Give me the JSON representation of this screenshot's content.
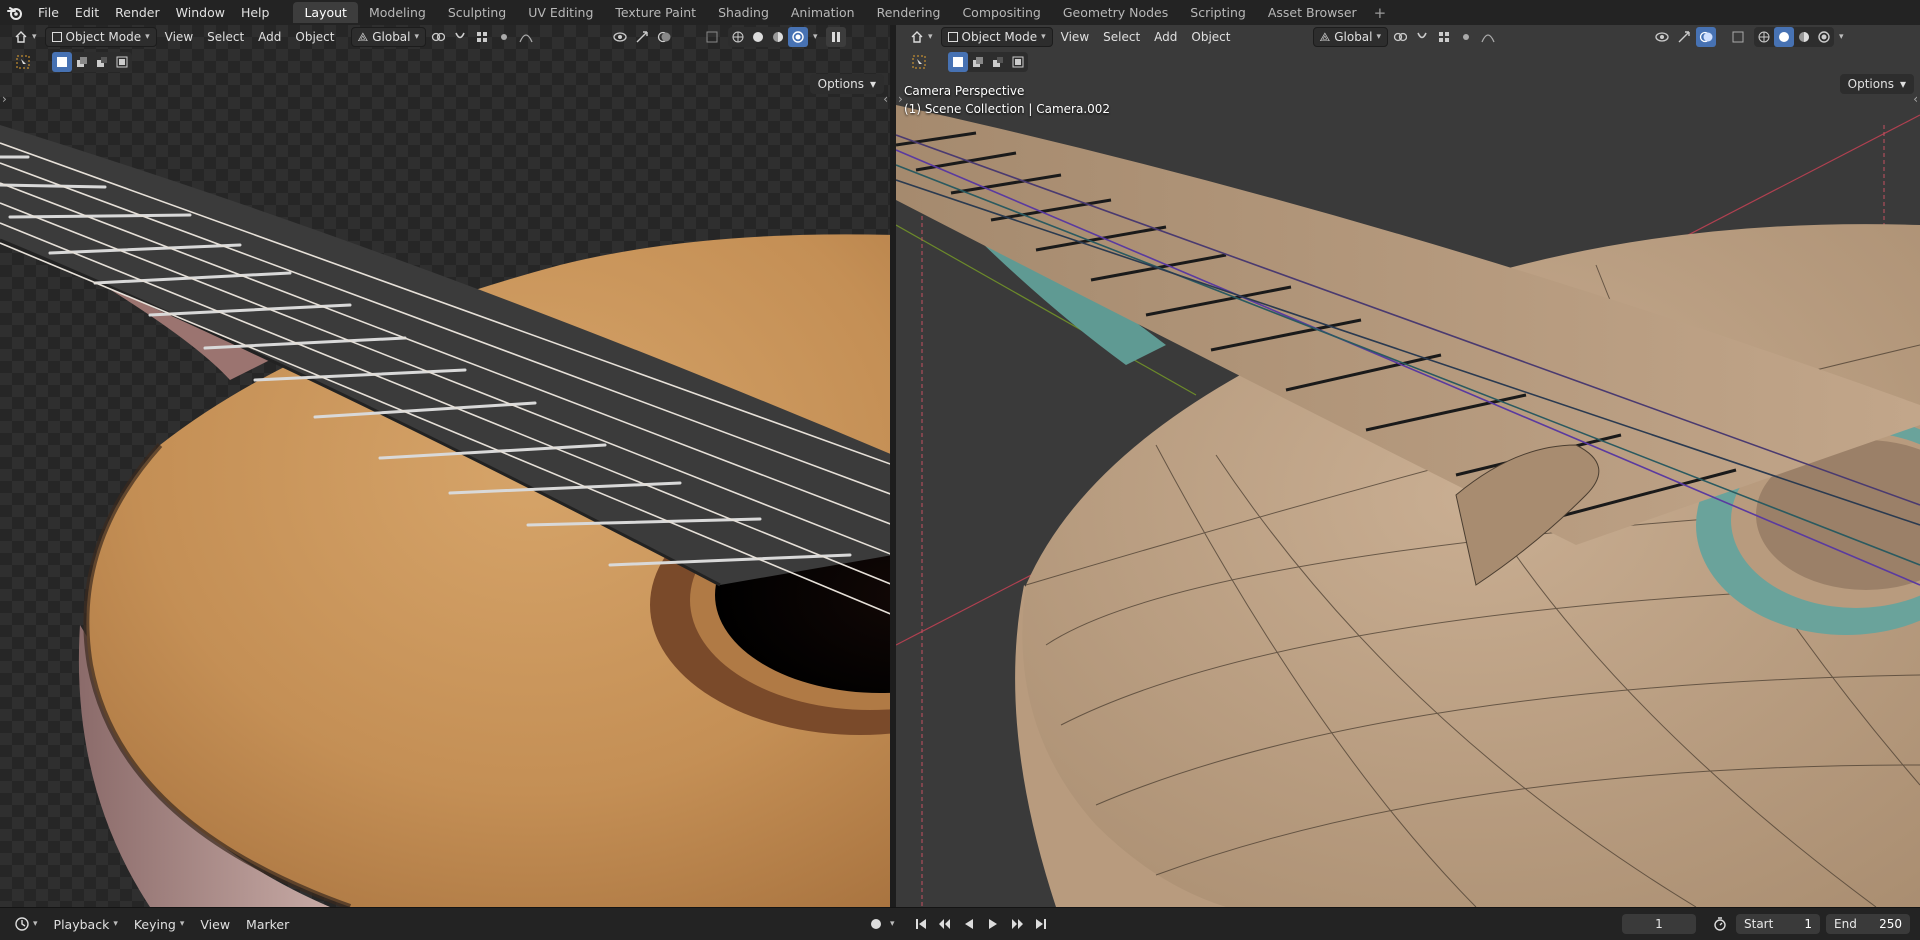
{
  "menu": {
    "items": [
      "File",
      "Edit",
      "Render",
      "Window",
      "Help"
    ]
  },
  "workspaces": {
    "tabs": [
      "Layout",
      "Modeling",
      "Sculpting",
      "UV Editing",
      "Texture Paint",
      "Shading",
      "Animation",
      "Rendering",
      "Compositing",
      "Geometry Nodes",
      "Scripting",
      "Asset Browser"
    ],
    "active": "Layout",
    "add_symbol": "+"
  },
  "left_viewport": {
    "mode": "Object Mode",
    "menus": [
      "View",
      "Select",
      "Add",
      "Object"
    ],
    "orientation": "Global",
    "options_label": "Options"
  },
  "right_viewport": {
    "mode": "Object Mode",
    "menus": [
      "View",
      "Select",
      "Add",
      "Object"
    ],
    "orientation": "Global",
    "options_label": "Options",
    "overlay_line1": "Camera Perspective",
    "overlay_line2": "(1) Scene Collection | Camera.002"
  },
  "timeline": {
    "menus": [
      "Playback",
      "Keying",
      "View",
      "Marker"
    ],
    "current_frame": "1",
    "start_label": "Start",
    "start_value": "1",
    "end_label": "End",
    "end_value": "250"
  },
  "colors": {
    "accent": "#4772b3",
    "active_tab": "#3d3d3d",
    "topbar": "#232323",
    "viewport_bg": "#3a3a3a",
    "wood": "#c8935a",
    "clay": "#bfa488"
  },
  "icons": {
    "logo": "blender-logo-icon",
    "play": "play-icon",
    "pause": "pause-icon"
  }
}
